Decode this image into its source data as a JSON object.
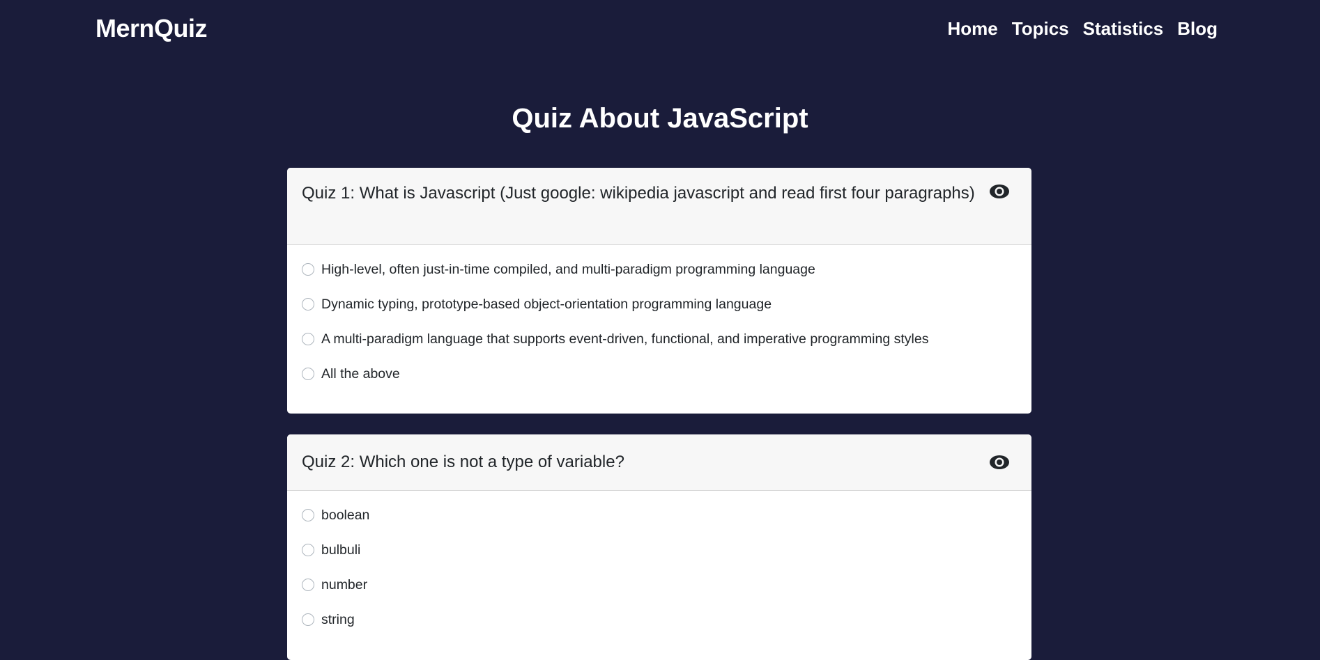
{
  "navbar": {
    "brand": "MernQuiz",
    "links": [
      "Home",
      "Topics",
      "Statistics",
      "Blog"
    ]
  },
  "page": {
    "title": "Quiz About JavaScript"
  },
  "quizzes": [
    {
      "question": "Quiz 1: What is Javascript (Just google: wikipedia javascript and read first four paragraphs)",
      "icon": "eye-icon",
      "options": [
        "High-level, often just-in-time compiled, and multi-paradigm programming language",
        "Dynamic typing, prototype-based object-orientation programming language",
        "A multi-paradigm language that supports event-driven, functional, and imperative programming styles",
        "All the above"
      ]
    },
    {
      "question": "Quiz 2: Which one is not a type of variable?",
      "icon": "eye-icon",
      "options": [
        "boolean",
        "bulbuli",
        "number",
        "string"
      ]
    }
  ],
  "colors": {
    "background": "#1a1c3a",
    "card_header": "#f7f7f7",
    "text": "#212529"
  }
}
